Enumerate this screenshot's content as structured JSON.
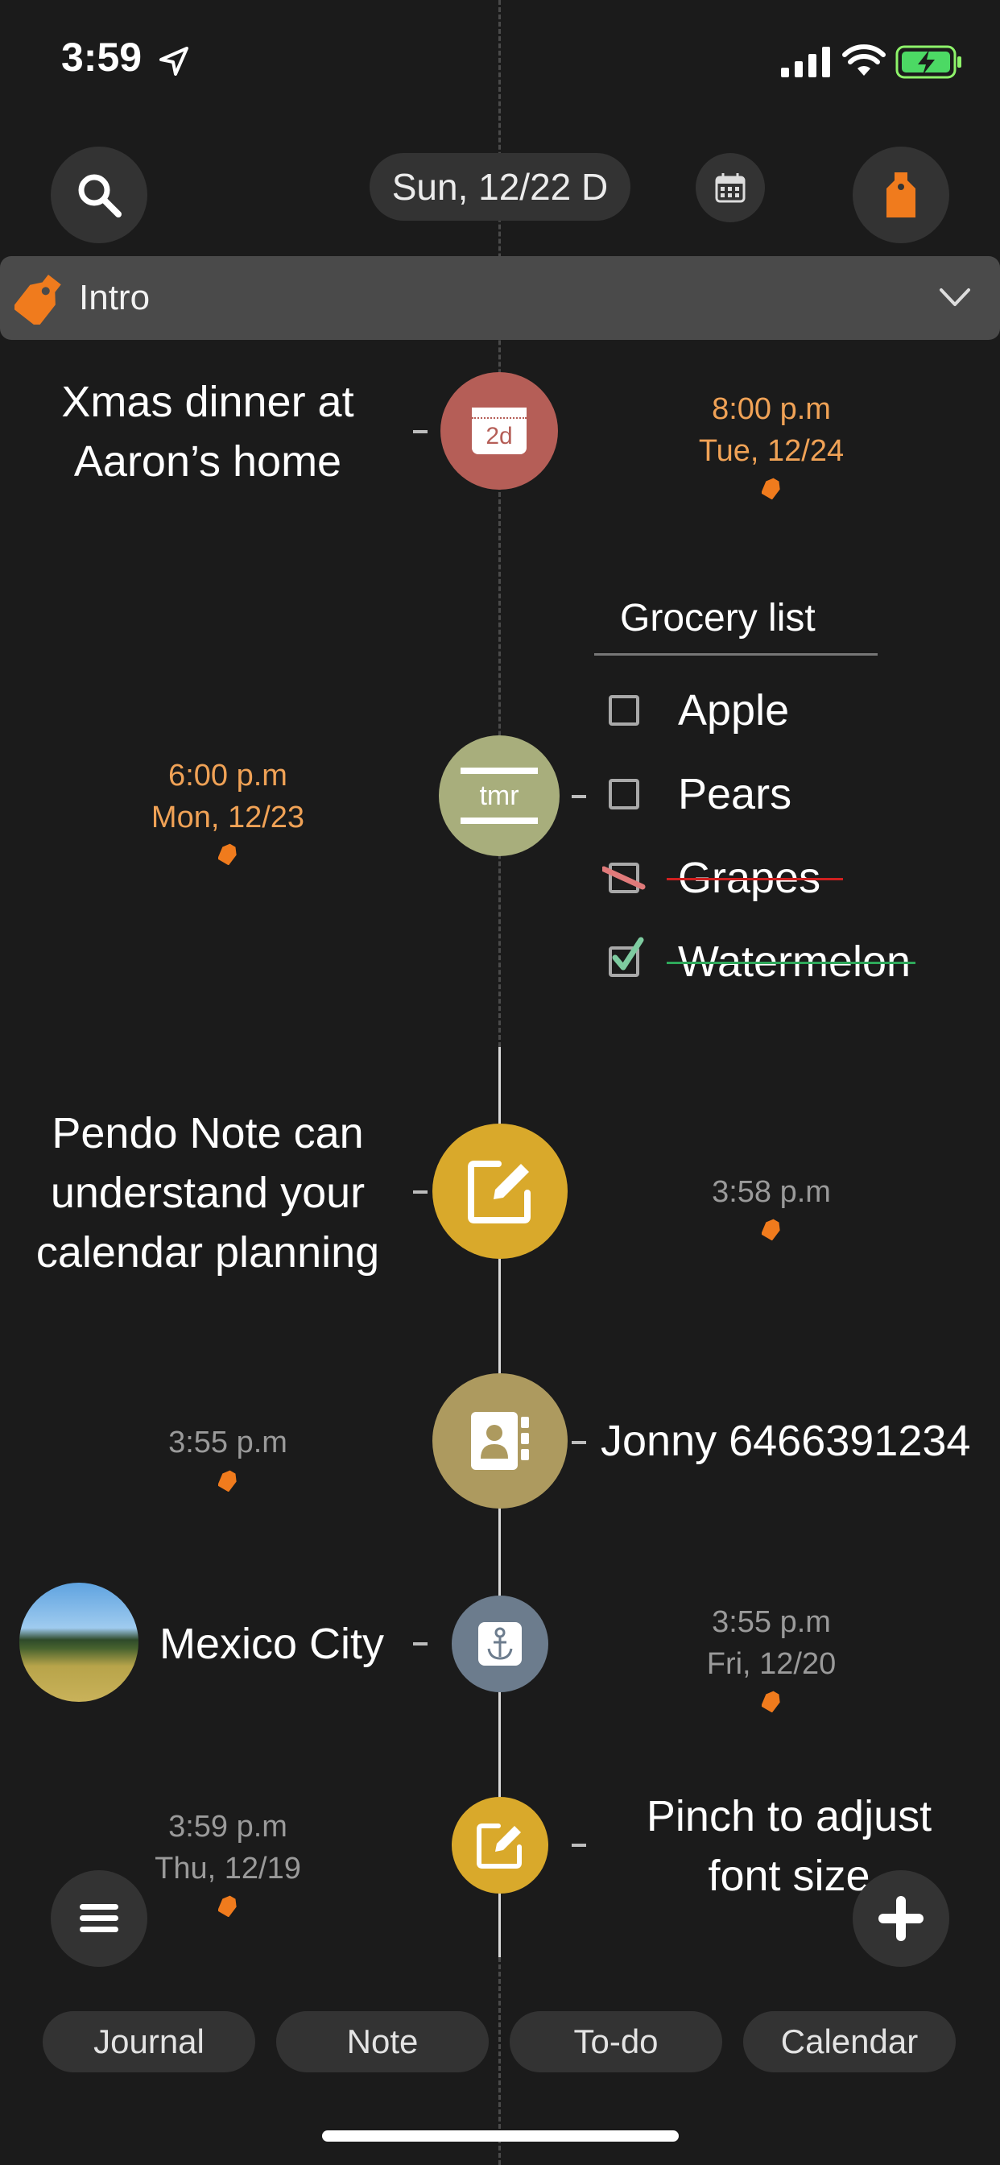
{
  "status_bar": {
    "time": "3:59"
  },
  "header": {
    "date_pill": "Sun, 12/22 D"
  },
  "tag_bar": {
    "label": "Intro"
  },
  "entries": {
    "xmas": {
      "line1": "Xmas dinner at",
      "line2": "Aaron’s home",
      "badge": "2d",
      "time": "8:00 p.m",
      "date": "Tue, 12/24"
    },
    "grocery": {
      "title": "Grocery list",
      "badge": "tmr",
      "time": "6:00 p.m",
      "date": "Mon, 12/23",
      "items": [
        {
          "label": "Apple",
          "checked": false,
          "struck": false
        },
        {
          "label": "Pears",
          "checked": false,
          "struck": false
        },
        {
          "label": "Grapes",
          "checked": false,
          "struck": true
        },
        {
          "label": "Watermelon",
          "checked": true,
          "struck": true
        }
      ]
    },
    "pendo": {
      "line1": "Pendo Note can",
      "line2": "understand your",
      "line3": "calendar planning",
      "time": "3:58 p.m"
    },
    "contact": {
      "text": "Jonny 6466391234",
      "time": "3:55 p.m"
    },
    "location": {
      "text": "Mexico City",
      "time": "3:55 p.m",
      "date": "Fri, 12/20"
    },
    "pinch": {
      "line1": "Pinch to adjust",
      "line2": "font size",
      "time": "3:59 p.m",
      "date": "Thu, 12/19"
    }
  },
  "bottom_tabs": [
    "Journal",
    "Note",
    "To-do",
    "Calendar"
  ],
  "colors": {
    "background": "#1b1b1b",
    "accent_orange": "#f07b1d",
    "time_orange": "#f0a256",
    "node_red": "#b55e57",
    "node_olive": "#a8ae7c",
    "node_gold": "#d9a92b",
    "node_khaki": "#ad9a5f",
    "node_slate": "#6c7c8d"
  }
}
